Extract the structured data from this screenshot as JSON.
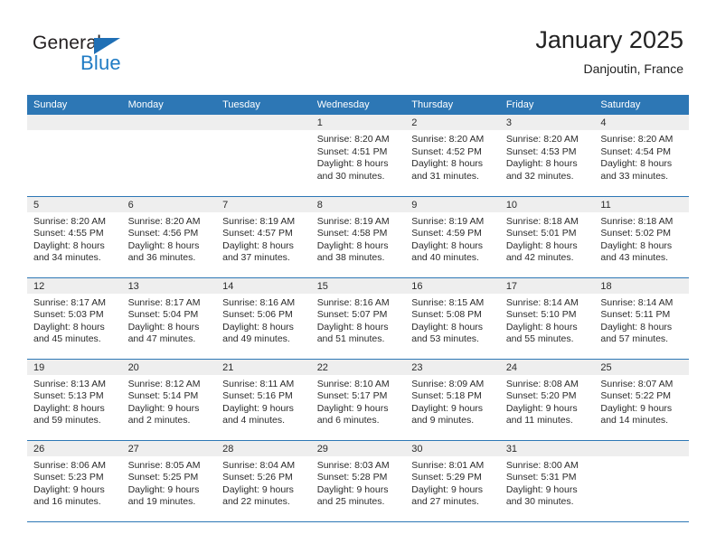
{
  "brand": {
    "name_top": "General",
    "name_bottom": "Blue",
    "triangle_icon": "triangle-icon",
    "color_blue": "#1f7bc4",
    "color_dark": "#231f20"
  },
  "header": {
    "title": "January 2025",
    "subtitle": "Danjoutin, France"
  },
  "colors": {
    "header_blue": "#2d77b5",
    "daynum_band": "#eeeeee",
    "row_divider": "#2d77b5",
    "text": "#2b2b2b"
  },
  "weekdays": [
    "Sunday",
    "Monday",
    "Tuesday",
    "Wednesday",
    "Thursday",
    "Friday",
    "Saturday"
  ],
  "weeks": [
    [
      {
        "day": "",
        "sunrise": "",
        "sunset": "",
        "daylight_1": "",
        "daylight_2": ""
      },
      {
        "day": "",
        "sunrise": "",
        "sunset": "",
        "daylight_1": "",
        "daylight_2": ""
      },
      {
        "day": "",
        "sunrise": "",
        "sunset": "",
        "daylight_1": "",
        "daylight_2": ""
      },
      {
        "day": "1",
        "sunrise": "Sunrise: 8:20 AM",
        "sunset": "Sunset: 4:51 PM",
        "daylight_1": "Daylight: 8 hours",
        "daylight_2": "and 30 minutes."
      },
      {
        "day": "2",
        "sunrise": "Sunrise: 8:20 AM",
        "sunset": "Sunset: 4:52 PM",
        "daylight_1": "Daylight: 8 hours",
        "daylight_2": "and 31 minutes."
      },
      {
        "day": "3",
        "sunrise": "Sunrise: 8:20 AM",
        "sunset": "Sunset: 4:53 PM",
        "daylight_1": "Daylight: 8 hours",
        "daylight_2": "and 32 minutes."
      },
      {
        "day": "4",
        "sunrise": "Sunrise: 8:20 AM",
        "sunset": "Sunset: 4:54 PM",
        "daylight_1": "Daylight: 8 hours",
        "daylight_2": "and 33 minutes."
      }
    ],
    [
      {
        "day": "5",
        "sunrise": "Sunrise: 8:20 AM",
        "sunset": "Sunset: 4:55 PM",
        "daylight_1": "Daylight: 8 hours",
        "daylight_2": "and 34 minutes."
      },
      {
        "day": "6",
        "sunrise": "Sunrise: 8:20 AM",
        "sunset": "Sunset: 4:56 PM",
        "daylight_1": "Daylight: 8 hours",
        "daylight_2": "and 36 minutes."
      },
      {
        "day": "7",
        "sunrise": "Sunrise: 8:19 AM",
        "sunset": "Sunset: 4:57 PM",
        "daylight_1": "Daylight: 8 hours",
        "daylight_2": "and 37 minutes."
      },
      {
        "day": "8",
        "sunrise": "Sunrise: 8:19 AM",
        "sunset": "Sunset: 4:58 PM",
        "daylight_1": "Daylight: 8 hours",
        "daylight_2": "and 38 minutes."
      },
      {
        "day": "9",
        "sunrise": "Sunrise: 8:19 AM",
        "sunset": "Sunset: 4:59 PM",
        "daylight_1": "Daylight: 8 hours",
        "daylight_2": "and 40 minutes."
      },
      {
        "day": "10",
        "sunrise": "Sunrise: 8:18 AM",
        "sunset": "Sunset: 5:01 PM",
        "daylight_1": "Daylight: 8 hours",
        "daylight_2": "and 42 minutes."
      },
      {
        "day": "11",
        "sunrise": "Sunrise: 8:18 AM",
        "sunset": "Sunset: 5:02 PM",
        "daylight_1": "Daylight: 8 hours",
        "daylight_2": "and 43 minutes."
      }
    ],
    [
      {
        "day": "12",
        "sunrise": "Sunrise: 8:17 AM",
        "sunset": "Sunset: 5:03 PM",
        "daylight_1": "Daylight: 8 hours",
        "daylight_2": "and 45 minutes."
      },
      {
        "day": "13",
        "sunrise": "Sunrise: 8:17 AM",
        "sunset": "Sunset: 5:04 PM",
        "daylight_1": "Daylight: 8 hours",
        "daylight_2": "and 47 minutes."
      },
      {
        "day": "14",
        "sunrise": "Sunrise: 8:16 AM",
        "sunset": "Sunset: 5:06 PM",
        "daylight_1": "Daylight: 8 hours",
        "daylight_2": "and 49 minutes."
      },
      {
        "day": "15",
        "sunrise": "Sunrise: 8:16 AM",
        "sunset": "Sunset: 5:07 PM",
        "daylight_1": "Daylight: 8 hours",
        "daylight_2": "and 51 minutes."
      },
      {
        "day": "16",
        "sunrise": "Sunrise: 8:15 AM",
        "sunset": "Sunset: 5:08 PM",
        "daylight_1": "Daylight: 8 hours",
        "daylight_2": "and 53 minutes."
      },
      {
        "day": "17",
        "sunrise": "Sunrise: 8:14 AM",
        "sunset": "Sunset: 5:10 PM",
        "daylight_1": "Daylight: 8 hours",
        "daylight_2": "and 55 minutes."
      },
      {
        "day": "18",
        "sunrise": "Sunrise: 8:14 AM",
        "sunset": "Sunset: 5:11 PM",
        "daylight_1": "Daylight: 8 hours",
        "daylight_2": "and 57 minutes."
      }
    ],
    [
      {
        "day": "19",
        "sunrise": "Sunrise: 8:13 AM",
        "sunset": "Sunset: 5:13 PM",
        "daylight_1": "Daylight: 8 hours",
        "daylight_2": "and 59 minutes."
      },
      {
        "day": "20",
        "sunrise": "Sunrise: 8:12 AM",
        "sunset": "Sunset: 5:14 PM",
        "daylight_1": "Daylight: 9 hours",
        "daylight_2": "and 2 minutes."
      },
      {
        "day": "21",
        "sunrise": "Sunrise: 8:11 AM",
        "sunset": "Sunset: 5:16 PM",
        "daylight_1": "Daylight: 9 hours",
        "daylight_2": "and 4 minutes."
      },
      {
        "day": "22",
        "sunrise": "Sunrise: 8:10 AM",
        "sunset": "Sunset: 5:17 PM",
        "daylight_1": "Daylight: 9 hours",
        "daylight_2": "and 6 minutes."
      },
      {
        "day": "23",
        "sunrise": "Sunrise: 8:09 AM",
        "sunset": "Sunset: 5:18 PM",
        "daylight_1": "Daylight: 9 hours",
        "daylight_2": "and 9 minutes."
      },
      {
        "day": "24",
        "sunrise": "Sunrise: 8:08 AM",
        "sunset": "Sunset: 5:20 PM",
        "daylight_1": "Daylight: 9 hours",
        "daylight_2": "and 11 minutes."
      },
      {
        "day": "25",
        "sunrise": "Sunrise: 8:07 AM",
        "sunset": "Sunset: 5:22 PM",
        "daylight_1": "Daylight: 9 hours",
        "daylight_2": "and 14 minutes."
      }
    ],
    [
      {
        "day": "26",
        "sunrise": "Sunrise: 8:06 AM",
        "sunset": "Sunset: 5:23 PM",
        "daylight_1": "Daylight: 9 hours",
        "daylight_2": "and 16 minutes."
      },
      {
        "day": "27",
        "sunrise": "Sunrise: 8:05 AM",
        "sunset": "Sunset: 5:25 PM",
        "daylight_1": "Daylight: 9 hours",
        "daylight_2": "and 19 minutes."
      },
      {
        "day": "28",
        "sunrise": "Sunrise: 8:04 AM",
        "sunset": "Sunset: 5:26 PM",
        "daylight_1": "Daylight: 9 hours",
        "daylight_2": "and 22 minutes."
      },
      {
        "day": "29",
        "sunrise": "Sunrise: 8:03 AM",
        "sunset": "Sunset: 5:28 PM",
        "daylight_1": "Daylight: 9 hours",
        "daylight_2": "and 25 minutes."
      },
      {
        "day": "30",
        "sunrise": "Sunrise: 8:01 AM",
        "sunset": "Sunset: 5:29 PM",
        "daylight_1": "Daylight: 9 hours",
        "daylight_2": "and 27 minutes."
      },
      {
        "day": "31",
        "sunrise": "Sunrise: 8:00 AM",
        "sunset": "Sunset: 5:31 PM",
        "daylight_1": "Daylight: 9 hours",
        "daylight_2": "and 30 minutes."
      },
      {
        "day": "",
        "sunrise": "",
        "sunset": "",
        "daylight_1": "",
        "daylight_2": ""
      }
    ]
  ]
}
